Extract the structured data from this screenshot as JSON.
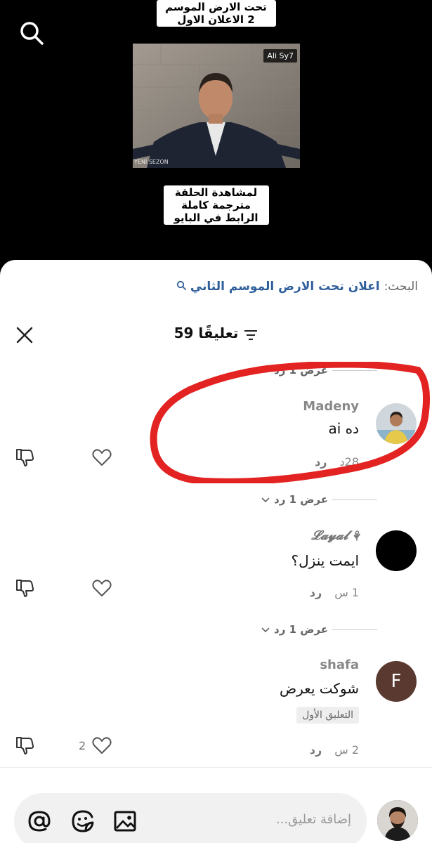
{
  "video": {
    "caption_top": "تحت الارض الموسم 2 الاعلان الاول",
    "thumb_tag": "Ali Sy7",
    "thumb_mark": "YENİ SEZON",
    "caption_bottom": "لمشاهدة الحلقة مترجمة كاملة الرابط في البايو"
  },
  "sheet": {
    "search_prefix": "البحث:",
    "search_query": "اعلان تحت الارض الموسم الثاني",
    "comment_count_label": "59 تعليقًا"
  },
  "toggles": [
    "عرض 1 رد",
    "عرض 1 رد",
    "عرض 1 رد"
  ],
  "comments": [
    {
      "username": "Madeny",
      "text": "ده ai",
      "time": "28د",
      "reply": "رد",
      "likes": ""
    },
    {
      "username": "𝓛𝓪𝔂𝓪𝓵 ⚘",
      "text": "ايمت ينزل؟",
      "time": "1 س",
      "reply": "رد",
      "likes": ""
    },
    {
      "username": "shafa",
      "text": "شوكت يعرض",
      "badge": "التعليق الأول",
      "time": "2 س",
      "reply": "رد",
      "likes": "2",
      "avatar_letter": "F"
    }
  ],
  "composer": {
    "placeholder": "إضافة تعليق..."
  },
  "colors": {
    "accent_link": "#2f5f9b",
    "annotation": "#e32222",
    "avatar_f": "#5a3a30"
  },
  "icons": [
    "search-icon",
    "close-icon",
    "filter-icon",
    "dislike-icon",
    "heart-icon",
    "at-icon",
    "emoji-icon",
    "image-icon",
    "chevron-down-icon"
  ]
}
